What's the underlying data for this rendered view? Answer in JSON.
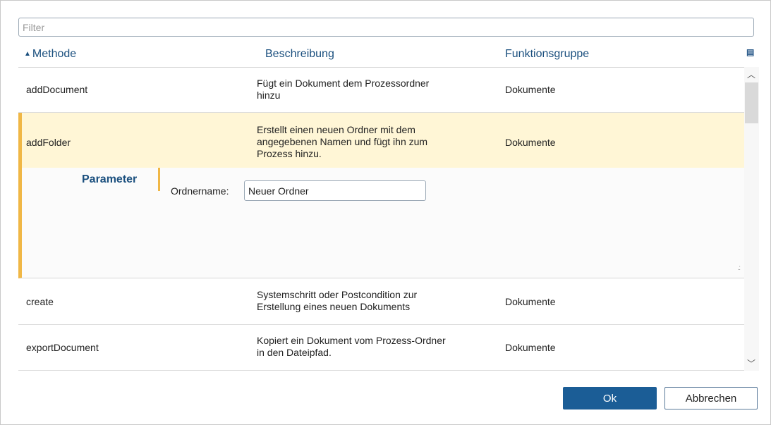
{
  "filter": {
    "placeholder": "Filter",
    "value": ""
  },
  "columns": {
    "method": "Methode",
    "description": "Beschreibung",
    "group": "Funktionsgruppe",
    "sort_icon": "sort-ascending-icon",
    "chooser_icon": "column-chooser-icon"
  },
  "rows": [
    {
      "method": "addDocument",
      "desc_lines": [
        "Fügt ein Dokument dem Prozessordner",
        "hinzu"
      ],
      "group": "Dokumente"
    },
    {
      "method": "addFolder",
      "desc_lines": [
        "Erstellt einen neuen Ordner mit dem",
        "angegebenen Namen und fügt ihn zum",
        "Prozess hinzu."
      ],
      "group": "Dokumente",
      "selected": true
    },
    {
      "method": "create",
      "desc_lines": [
        "Systemschritt oder Postcondition zur",
        "Erstellung eines neuen Dokuments"
      ],
      "group": "Dokumente"
    },
    {
      "method": "exportDocument",
      "desc_lines": [
        "Kopiert ein Dokument vom Prozess-Ordner",
        "in den Dateipfad."
      ],
      "group": "Dokumente"
    }
  ],
  "parameter": {
    "title": "Parameter",
    "label": "Ordnername:",
    "value": "Neuer Ordner"
  },
  "buttons": {
    "ok": "Ok",
    "cancel": "Abbrechen"
  },
  "colors": {
    "accent": "#1b5d96",
    "selection": "#fff6d6",
    "selection_border": "#f0b746",
    "header_text": "#1a4f7e"
  }
}
